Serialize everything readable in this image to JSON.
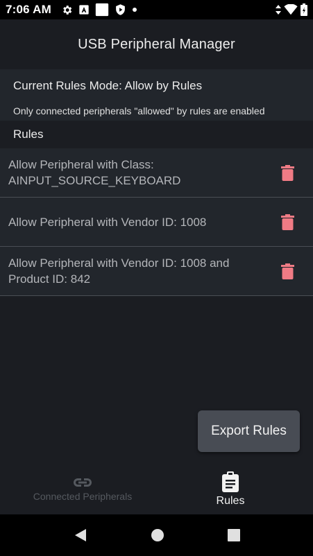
{
  "status_bar": {
    "time": "7:06 AM",
    "icons_left": [
      "gear-icon",
      "a-box-icon",
      "white-square-icon",
      "shield-play-icon",
      "dot-icon"
    ],
    "icons_right": [
      "data-arrows-icon",
      "wifi-icon",
      "battery-icon"
    ]
  },
  "app": {
    "title": "USB Peripheral Manager"
  },
  "mode": {
    "title": "Current Rules Mode: Allow by Rules",
    "description": "Only connected peripherals \"allowed\" by rules are enabled"
  },
  "rules_section": {
    "title": "Rules"
  },
  "rules": [
    {
      "text": "Allow Peripheral with Class: AINPUT_SOURCE_KEYBOARD"
    },
    {
      "text": "Allow Peripheral with Vendor ID: 1008"
    },
    {
      "text": "Allow Peripheral with Vendor ID: 1008 and Product ID: 842"
    }
  ],
  "export_button": {
    "label": "Export Rules"
  },
  "bottom_nav": {
    "items": [
      {
        "label": "Connected Peripherals",
        "icon": "link-icon",
        "active": false
      },
      {
        "label": "Rules",
        "icon": "clipboard-icon",
        "active": true
      }
    ]
  },
  "colors": {
    "accent_delete": "#f07b85",
    "background": "#1b1d22",
    "panel": "#22262c",
    "button": "#484c54"
  }
}
